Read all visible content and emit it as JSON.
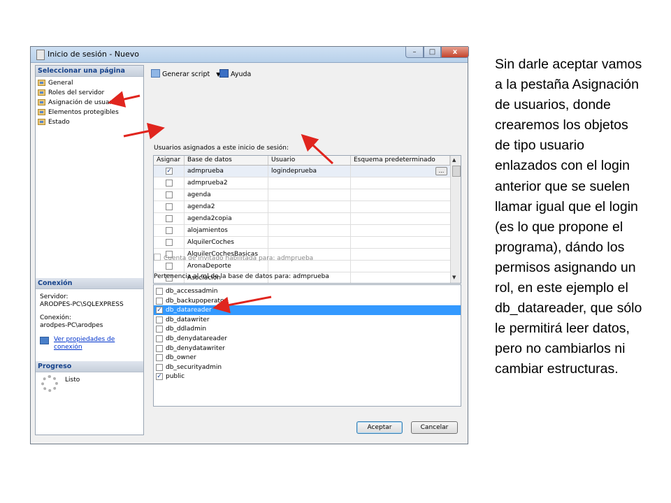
{
  "window": {
    "title": "Inicio de sesión - Nuevo",
    "controls": {
      "minimize": "–",
      "maximize": "□",
      "close": "x"
    }
  },
  "left_pane": {
    "select_page_header": "Seleccionar una página",
    "pages": [
      "General",
      "Roles del servidor",
      "Asignación de usuarios",
      "Elementos protegibles",
      "Estado"
    ],
    "connection_header": "Conexión",
    "server_label": "Servidor:",
    "server_value": "ARODPES-PC\\SQLEXPRESS",
    "connection_label": "Conexión:",
    "connection_value": "arodpes-PC\\arodpes",
    "view_properties_line1": "Ver propiedades de",
    "view_properties_line2": "conexión",
    "progress_header": "Progreso",
    "progress_status": "Listo"
  },
  "toolbar": {
    "script_label": "Generar script",
    "help_label": "Ayuda"
  },
  "users_grid": {
    "label": "Usuarios asignados a este inicio de sesión:",
    "columns": [
      "Asignar",
      "Base de datos",
      "Usuario",
      "Esquema predeterminado"
    ],
    "rows": [
      {
        "checked": true,
        "database": "admprueba",
        "user": "logindeprueba",
        "schema": ""
      },
      {
        "checked": false,
        "database": "admprueba2",
        "user": "",
        "schema": ""
      },
      {
        "checked": false,
        "database": "agenda",
        "user": "",
        "schema": ""
      },
      {
        "checked": false,
        "database": "agenda2",
        "user": "",
        "schema": ""
      },
      {
        "checked": false,
        "database": "agenda2copia",
        "user": "",
        "schema": ""
      },
      {
        "checked": false,
        "database": "alojamientos",
        "user": "",
        "schema": ""
      },
      {
        "checked": false,
        "database": "AlquilerCoches",
        "user": "",
        "schema": ""
      },
      {
        "checked": false,
        "database": "AlquilerCochesBasicas",
        "user": "",
        "schema": ""
      },
      {
        "checked": false,
        "database": "AronaDeporte",
        "user": "",
        "schema": ""
      },
      {
        "checked": false,
        "database": "Asociacion",
        "user": "",
        "schema": ""
      }
    ],
    "ellipsis": "..."
  },
  "guest_checkbox_label": "Cuenta de invitado habilitada para: admprueba",
  "roles": {
    "label": "Pertenencia al rol de la base de datos para: admprueba",
    "items": [
      {
        "name": "db_accessadmin",
        "checked": false,
        "selected": false
      },
      {
        "name": "db_backupoperator",
        "checked": false,
        "selected": false
      },
      {
        "name": "db_datareader",
        "checked": true,
        "selected": true
      },
      {
        "name": "db_datawriter",
        "checked": false,
        "selected": false
      },
      {
        "name": "db_ddladmin",
        "checked": false,
        "selected": false
      },
      {
        "name": "db_denydatareader",
        "checked": false,
        "selected": false
      },
      {
        "name": "db_denydatawriter",
        "checked": false,
        "selected": false
      },
      {
        "name": "db_owner",
        "checked": false,
        "selected": false
      },
      {
        "name": "db_securityadmin",
        "checked": false,
        "selected": false
      },
      {
        "name": "public",
        "checked": true,
        "selected": false
      }
    ]
  },
  "buttons": {
    "ok": "Aceptar",
    "cancel": "Cancelar"
  },
  "side_text": [
    "Sin darle aceptar vamos",
    "a la pestaña Asignación",
    "de usuarios, donde",
    "crearemos los objetos",
    "de tipo usuario",
    "enlazados  con el login",
    "anterior que se suelen",
    "llamar igual que el login",
    "(es lo que propone el",
    "programa), dándo los",
    "permisos asignando un",
    "rol, en este ejemplo el",
    "db_datareader, que sólo",
    "le permitirá leer datos,",
    "pero no cambiarlos ni",
    "cambiar estructuras."
  ],
  "colors": {
    "selection": "#3399ff",
    "arrow": "#e0251e",
    "link": "#0033cc"
  }
}
